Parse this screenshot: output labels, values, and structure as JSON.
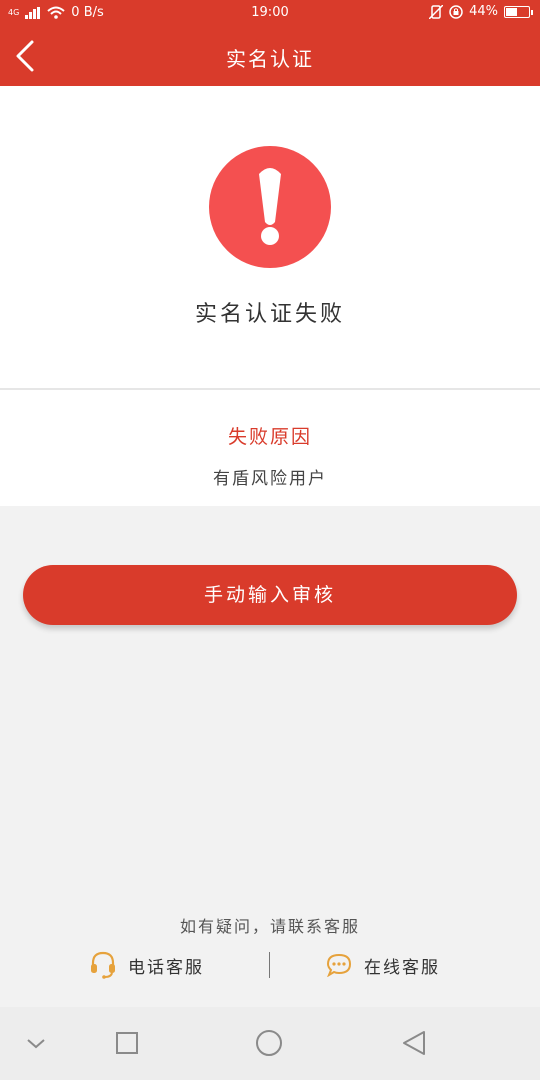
{
  "status_bar": {
    "network": "4G",
    "speed": "0 B/s",
    "time": "19:00",
    "battery": "44%",
    "battery_level": 0.44
  },
  "header": {
    "title": "实名认证"
  },
  "result": {
    "title": "实名认证失败"
  },
  "reason": {
    "title": "失败原因",
    "text": "有盾风险用户"
  },
  "manual_button": {
    "label": "手动输入审核"
  },
  "help": {
    "text": "如有疑问，请联系客服"
  },
  "contact": {
    "phone_label": "电话客服",
    "online_label": "在线客服"
  },
  "colors": {
    "brand": "#d93b2b",
    "alert": "#f45050",
    "icon_gold": "#e6a23c",
    "background": "#f2f2f2"
  },
  "icons": {
    "back": "chevron-left-icon",
    "alert": "exclamation-icon",
    "phone": "headset-icon",
    "online": "chat-bubble-icon",
    "nav": [
      "chevron-down-icon",
      "square-icon",
      "circle-icon",
      "triangle-back-icon"
    ]
  }
}
